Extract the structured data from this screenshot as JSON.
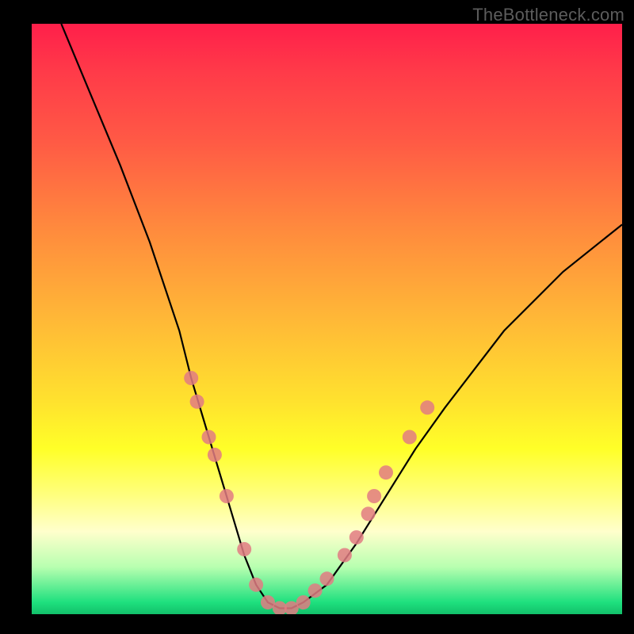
{
  "watermark": "TheBottleneck.com",
  "chart_data": {
    "type": "line",
    "title": "",
    "xlabel": "",
    "ylabel": "",
    "xlim": [
      0,
      100
    ],
    "ylim": [
      0,
      100
    ],
    "series": [
      {
        "name": "bottleneck-curve",
        "x": [
          5,
          10,
          15,
          20,
          25,
          27,
          30,
          33,
          36,
          38,
          40,
          42,
          44,
          46,
          50,
          55,
          60,
          65,
          70,
          80,
          90,
          100
        ],
        "y": [
          100,
          88,
          76,
          63,
          48,
          40,
          30,
          20,
          10,
          5,
          2,
          1,
          1,
          2,
          5,
          12,
          20,
          28,
          35,
          48,
          58,
          66
        ]
      }
    ],
    "markers": [
      {
        "x": 27,
        "y": 40
      },
      {
        "x": 28,
        "y": 36
      },
      {
        "x": 30,
        "y": 30
      },
      {
        "x": 31,
        "y": 27
      },
      {
        "x": 33,
        "y": 20
      },
      {
        "x": 36,
        "y": 11
      },
      {
        "x": 38,
        "y": 5
      },
      {
        "x": 40,
        "y": 2
      },
      {
        "x": 42,
        "y": 1
      },
      {
        "x": 44,
        "y": 1
      },
      {
        "x": 46,
        "y": 2
      },
      {
        "x": 48,
        "y": 4
      },
      {
        "x": 50,
        "y": 6
      },
      {
        "x": 53,
        "y": 10
      },
      {
        "x": 55,
        "y": 13
      },
      {
        "x": 57,
        "y": 17
      },
      {
        "x": 58,
        "y": 20
      },
      {
        "x": 60,
        "y": 24
      },
      {
        "x": 64,
        "y": 30
      },
      {
        "x": 67,
        "y": 35
      }
    ],
    "marker_color": "#e27b83",
    "curve_color": "#000000"
  }
}
